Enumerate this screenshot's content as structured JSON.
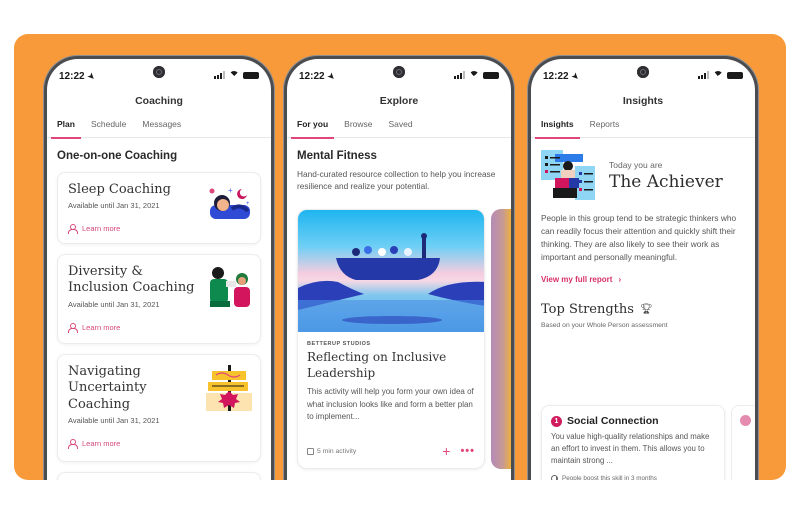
{
  "brand": {
    "background": "#f89a3a",
    "accent": "#e0457b",
    "link": "#d6306b"
  },
  "status_bar": {
    "time": "12:22"
  },
  "phones": [
    {
      "screen_title": "Coaching",
      "tabs": [
        {
          "label": "Plan",
          "active": true
        },
        {
          "label": "Schedule",
          "active": false
        },
        {
          "label": "Messages",
          "active": false
        }
      ],
      "section_heading": "One-on-one Coaching",
      "cards": [
        {
          "title": "Sleep Coaching",
          "availability": "Available until Jan 31, 2021",
          "link": "Learn more",
          "illustration": "sleeping-person-illustration"
        },
        {
          "title": "Diversity & Inclusion Coaching",
          "availability": "Available until Jan 31, 2021",
          "link": "Learn more",
          "illustration": "diverse-people-illustration"
        },
        {
          "title": "Navigating Uncertainty Coaching",
          "availability": "Available until Jan 31, 2021",
          "link": "Learn more",
          "illustration": "signpost-illustration"
        }
      ]
    },
    {
      "screen_title": "Explore",
      "tabs": [
        {
          "label": "For you",
          "active": true
        },
        {
          "label": "Browse",
          "active": false
        },
        {
          "label": "Saved",
          "active": false
        }
      ],
      "section_heading": "Mental Fitness",
      "description": "Hand-curated resource collection to help you increase resilience and realize your potential.",
      "resource": {
        "kicker": "BETTERUP STUDIOS",
        "title": "Reflecting on Inclusive Leadership",
        "text": "This activity will help you form your own idea of what inclusion looks like and form a better plan to implement...",
        "meta": "5 min activity",
        "add_label": "+",
        "more_label": "•••"
      }
    },
    {
      "screen_title": "Insights",
      "tabs": [
        {
          "label": "Insights",
          "active": true
        },
        {
          "label": "Reports",
          "active": false
        }
      ],
      "today_label": "Today you are",
      "persona": "The Achiever",
      "description": "People in this group tend to be strategic thinkers who can readily focus their attention and quickly shift their thinking. They are also likely to see their work as important and personally meaningful.",
      "report_link": "View my full report",
      "strengths_heading": "Top Strengths",
      "strengths_sub": "Based on your Whole Person assessment",
      "strength": {
        "rank": "1",
        "title": "Social Connection",
        "text": "You value high-quality relationships and make an effort to invest in them. This allows you to maintain strong ...",
        "footer": "People boost this skill in 3 months"
      }
    }
  ]
}
